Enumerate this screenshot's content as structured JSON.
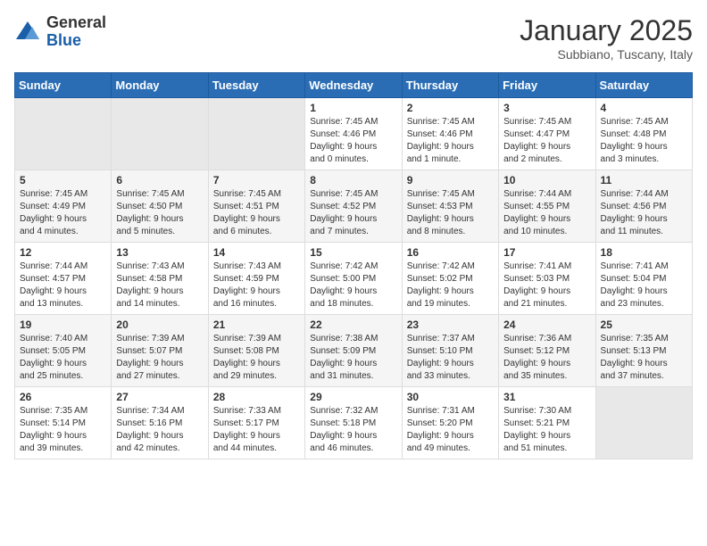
{
  "header": {
    "logo_general": "General",
    "logo_blue": "Blue",
    "month_title": "January 2025",
    "subtitle": "Subbiano, Tuscany, Italy"
  },
  "weekdays": [
    "Sunday",
    "Monday",
    "Tuesday",
    "Wednesday",
    "Thursday",
    "Friday",
    "Saturday"
  ],
  "weeks": [
    [
      {
        "day": "",
        "info": ""
      },
      {
        "day": "",
        "info": ""
      },
      {
        "day": "",
        "info": ""
      },
      {
        "day": "1",
        "info": "Sunrise: 7:45 AM\nSunset: 4:46 PM\nDaylight: 9 hours\nand 0 minutes."
      },
      {
        "day": "2",
        "info": "Sunrise: 7:45 AM\nSunset: 4:46 PM\nDaylight: 9 hours\nand 1 minute."
      },
      {
        "day": "3",
        "info": "Sunrise: 7:45 AM\nSunset: 4:47 PM\nDaylight: 9 hours\nand 2 minutes."
      },
      {
        "day": "4",
        "info": "Sunrise: 7:45 AM\nSunset: 4:48 PM\nDaylight: 9 hours\nand 3 minutes."
      }
    ],
    [
      {
        "day": "5",
        "info": "Sunrise: 7:45 AM\nSunset: 4:49 PM\nDaylight: 9 hours\nand 4 minutes."
      },
      {
        "day": "6",
        "info": "Sunrise: 7:45 AM\nSunset: 4:50 PM\nDaylight: 9 hours\nand 5 minutes."
      },
      {
        "day": "7",
        "info": "Sunrise: 7:45 AM\nSunset: 4:51 PM\nDaylight: 9 hours\nand 6 minutes."
      },
      {
        "day": "8",
        "info": "Sunrise: 7:45 AM\nSunset: 4:52 PM\nDaylight: 9 hours\nand 7 minutes."
      },
      {
        "day": "9",
        "info": "Sunrise: 7:45 AM\nSunset: 4:53 PM\nDaylight: 9 hours\nand 8 minutes."
      },
      {
        "day": "10",
        "info": "Sunrise: 7:44 AM\nSunset: 4:55 PM\nDaylight: 9 hours\nand 10 minutes."
      },
      {
        "day": "11",
        "info": "Sunrise: 7:44 AM\nSunset: 4:56 PM\nDaylight: 9 hours\nand 11 minutes."
      }
    ],
    [
      {
        "day": "12",
        "info": "Sunrise: 7:44 AM\nSunset: 4:57 PM\nDaylight: 9 hours\nand 13 minutes."
      },
      {
        "day": "13",
        "info": "Sunrise: 7:43 AM\nSunset: 4:58 PM\nDaylight: 9 hours\nand 14 minutes."
      },
      {
        "day": "14",
        "info": "Sunrise: 7:43 AM\nSunset: 4:59 PM\nDaylight: 9 hours\nand 16 minutes."
      },
      {
        "day": "15",
        "info": "Sunrise: 7:42 AM\nSunset: 5:00 PM\nDaylight: 9 hours\nand 18 minutes."
      },
      {
        "day": "16",
        "info": "Sunrise: 7:42 AM\nSunset: 5:02 PM\nDaylight: 9 hours\nand 19 minutes."
      },
      {
        "day": "17",
        "info": "Sunrise: 7:41 AM\nSunset: 5:03 PM\nDaylight: 9 hours\nand 21 minutes."
      },
      {
        "day": "18",
        "info": "Sunrise: 7:41 AM\nSunset: 5:04 PM\nDaylight: 9 hours\nand 23 minutes."
      }
    ],
    [
      {
        "day": "19",
        "info": "Sunrise: 7:40 AM\nSunset: 5:05 PM\nDaylight: 9 hours\nand 25 minutes."
      },
      {
        "day": "20",
        "info": "Sunrise: 7:39 AM\nSunset: 5:07 PM\nDaylight: 9 hours\nand 27 minutes."
      },
      {
        "day": "21",
        "info": "Sunrise: 7:39 AM\nSunset: 5:08 PM\nDaylight: 9 hours\nand 29 minutes."
      },
      {
        "day": "22",
        "info": "Sunrise: 7:38 AM\nSunset: 5:09 PM\nDaylight: 9 hours\nand 31 minutes."
      },
      {
        "day": "23",
        "info": "Sunrise: 7:37 AM\nSunset: 5:10 PM\nDaylight: 9 hours\nand 33 minutes."
      },
      {
        "day": "24",
        "info": "Sunrise: 7:36 AM\nSunset: 5:12 PM\nDaylight: 9 hours\nand 35 minutes."
      },
      {
        "day": "25",
        "info": "Sunrise: 7:35 AM\nSunset: 5:13 PM\nDaylight: 9 hours\nand 37 minutes."
      }
    ],
    [
      {
        "day": "26",
        "info": "Sunrise: 7:35 AM\nSunset: 5:14 PM\nDaylight: 9 hours\nand 39 minutes."
      },
      {
        "day": "27",
        "info": "Sunrise: 7:34 AM\nSunset: 5:16 PM\nDaylight: 9 hours\nand 42 minutes."
      },
      {
        "day": "28",
        "info": "Sunrise: 7:33 AM\nSunset: 5:17 PM\nDaylight: 9 hours\nand 44 minutes."
      },
      {
        "day": "29",
        "info": "Sunrise: 7:32 AM\nSunset: 5:18 PM\nDaylight: 9 hours\nand 46 minutes."
      },
      {
        "day": "30",
        "info": "Sunrise: 7:31 AM\nSunset: 5:20 PM\nDaylight: 9 hours\nand 49 minutes."
      },
      {
        "day": "31",
        "info": "Sunrise: 7:30 AM\nSunset: 5:21 PM\nDaylight: 9 hours\nand 51 minutes."
      },
      {
        "day": "",
        "info": ""
      }
    ]
  ]
}
